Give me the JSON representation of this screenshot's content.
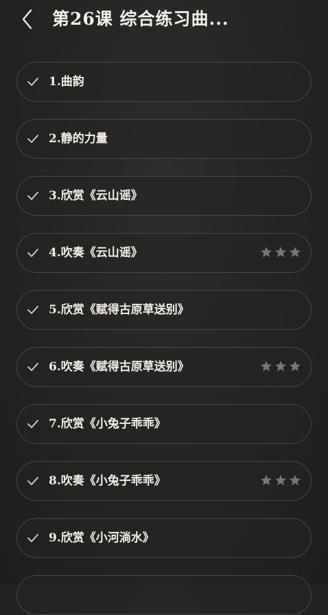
{
  "header": {
    "back_icon": "chevron-left-icon",
    "title": "第26课 综合练习曲..."
  },
  "colors": {
    "background": "#262523",
    "text": "#f2eee5",
    "item_border": "#4a4946",
    "check": "#d8d4cc",
    "star": "#7a7770"
  },
  "lessons": [
    {
      "label": "1.曲韵",
      "completed": true,
      "stars": 0
    },
    {
      "label": "2.静的力量",
      "completed": true,
      "stars": 0
    },
    {
      "label": "3.欣赏《云山谣》",
      "completed": true,
      "stars": 0
    },
    {
      "label": "4.吹奏《云山谣》",
      "completed": true,
      "stars": 3
    },
    {
      "label": "5.欣赏《赋得古原草送别》",
      "completed": true,
      "stars": 0
    },
    {
      "label": "6.吹奏《赋得古原草送别》",
      "completed": true,
      "stars": 3
    },
    {
      "label": "7.欣赏《小兔子乖乖》",
      "completed": true,
      "stars": 0
    },
    {
      "label": "8.吹奏《小兔子乖乖》",
      "completed": true,
      "stars": 3
    },
    {
      "label": "9.欣赏《小河淌水》",
      "completed": true,
      "stars": 0
    },
    {
      "label": "",
      "completed": false,
      "stars": 0
    }
  ]
}
